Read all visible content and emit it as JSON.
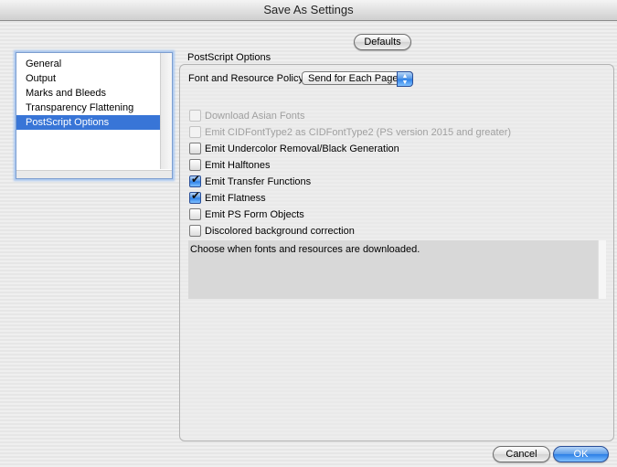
{
  "window": {
    "title": "Save As Settings"
  },
  "toolbar": {
    "defaults_label": "Defaults"
  },
  "sidebar": {
    "items": [
      {
        "label": "General",
        "selected": false
      },
      {
        "label": "Output",
        "selected": false
      },
      {
        "label": "Marks and Bleeds",
        "selected": false
      },
      {
        "label": "Transparency Flattening",
        "selected": false
      },
      {
        "label": "PostScript Options",
        "selected": true
      }
    ]
  },
  "panel": {
    "title": "PostScript Options",
    "policy_label": "Font and Resource Policy:",
    "policy_value": "Send for Each Page",
    "options": [
      {
        "label": "Download Asian Fonts",
        "checked": false,
        "enabled": false
      },
      {
        "label": "Emit CIDFontType2 as CIDFontType2 (PS version 2015 and greater)",
        "checked": false,
        "enabled": false
      },
      {
        "label": "Emit Undercolor Removal/Black Generation",
        "checked": false,
        "enabled": true
      },
      {
        "label": "Emit Halftones",
        "checked": false,
        "enabled": true
      },
      {
        "label": "Emit Transfer Functions",
        "checked": true,
        "enabled": true
      },
      {
        "label": "Emit Flatness",
        "checked": true,
        "enabled": true
      },
      {
        "label": "Emit PS Form Objects",
        "checked": false,
        "enabled": true
      },
      {
        "label": "Discolored background correction",
        "checked": false,
        "enabled": true
      }
    ],
    "description": "Choose when fonts and resources are downloaded."
  },
  "footer": {
    "cancel_label": "Cancel",
    "ok_label": "OK"
  },
  "colors": {
    "selection": "#3875d7",
    "accent_blue": "#2b7ee6"
  }
}
